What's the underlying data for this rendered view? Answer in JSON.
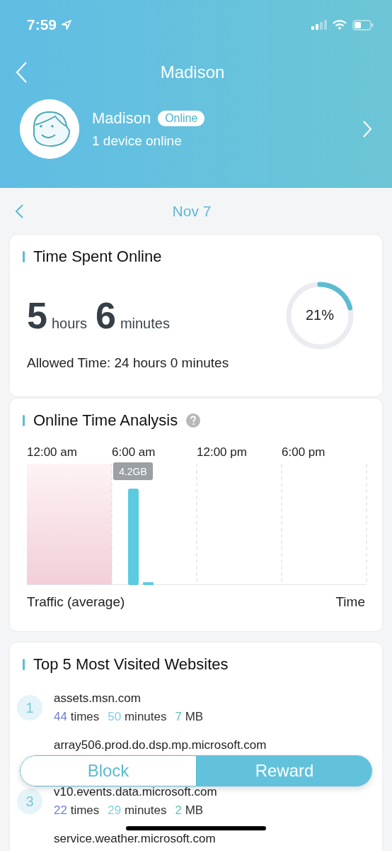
{
  "status_bar": {
    "time": "7:59"
  },
  "nav": {
    "title": "Madison"
  },
  "profile": {
    "name": "Madison",
    "badge": "Online",
    "subtitle": "1 device online"
  },
  "date": {
    "label": "Nov 7"
  },
  "time_card": {
    "title": "Time Spent Online",
    "hours": "5",
    "hours_unit": "hours",
    "minutes": "6",
    "minutes_unit": "minutes",
    "percent": "21%",
    "allowed": "Allowed Time: 24 hours 0 minutes"
  },
  "analysis": {
    "title": "Online Time Analysis",
    "x_labels": [
      "12:00 am",
      "6:00 am",
      "12:00 pm",
      "6:00 pm"
    ],
    "tooltip": "4.2GB",
    "left_label": "Traffic (average)",
    "right_label": "Time"
  },
  "websites": {
    "title": "Top 5 Most Visited Websites",
    "items": [
      {
        "rank": "1",
        "domain": "assets.msn.com",
        "stats": [
          {
            "kind": "times",
            "value": "44",
            "unit": "times"
          },
          {
            "kind": "minutes",
            "value": "50",
            "unit": "minutes"
          },
          {
            "kind": "size",
            "value": "7",
            "unit": "MB"
          }
        ]
      },
      {
        "domain": "array506.prod.do.dsp.mp.microsoft.com"
      },
      {
        "rank": "3",
        "domain": "v10.events.data.microsoft.com",
        "stats": [
          {
            "kind": "times",
            "value": "22",
            "unit": "times"
          },
          {
            "kind": "minutes",
            "value": "29",
            "unit": "minutes"
          },
          {
            "kind": "size",
            "value": "2",
            "unit": "MB"
          }
        ]
      },
      {
        "domain": "service.weather.microsoft.com"
      }
    ]
  },
  "actions": [
    {
      "kind": "outline",
      "label": "Block"
    },
    {
      "kind": "filled",
      "label": "Reward"
    }
  ]
}
